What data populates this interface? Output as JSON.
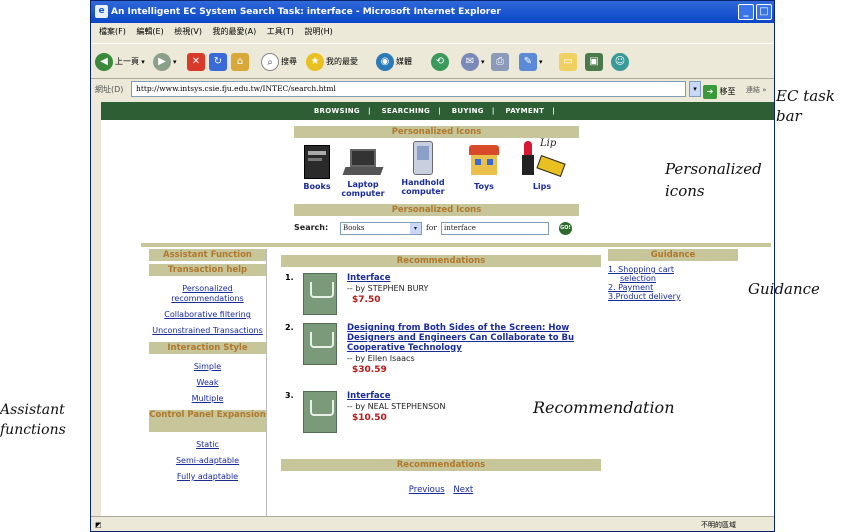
{
  "window": {
    "title": "An Intelligent EC System Search Task: interface - Microsoft Internet Explorer",
    "min": "_",
    "max": "□"
  },
  "menu": [
    "檔案(F)",
    "編輯(E)",
    "檢視(V)",
    "我的最愛(A)",
    "工具(T)",
    "說明(H)"
  ],
  "toolbar": {
    "back": "上一頁",
    "search": "搜尋",
    "favorites": "我的最愛",
    "media": "媒體"
  },
  "address": {
    "label": "網址(D)",
    "url": "http://www.intsys.csie.fju.edu.tw/INTEC/search.html",
    "go": "移至",
    "links": "連結"
  },
  "taskbar": [
    "BROWSING",
    "SEARCHING",
    "BUYING",
    "PAYMENT"
  ],
  "personalized": {
    "header": "Personalized Icons",
    "footer": "Personalized Icons",
    "icons": [
      {
        "label1": "Books",
        "label2": ""
      },
      {
        "label1": "Laptop",
        "label2": "computer"
      },
      {
        "label1": "Handhold",
        "label2": "computer"
      },
      {
        "label1": "Toys",
        "label2": ""
      },
      {
        "label1": "Lips",
        "label2": ""
      }
    ],
    "lip_text": "Lip"
  },
  "search": {
    "label": "Search:",
    "category": "Books",
    "for_label": "for",
    "query": "interface",
    "go": "GO!"
  },
  "assistant": {
    "header": "Assistant Function",
    "transaction_help": "Transaction help",
    "links_a": [
      "Personalized recommendations",
      "Collaborative filtering",
      "Unconstrained Transactions"
    ],
    "interaction_style": "Interaction Style",
    "links_b": [
      "Simple",
      "Weak",
      "Multiple"
    ],
    "control_panel": "Control Panel Expansion",
    "links_c": [
      "Static",
      "Semi-adaptable",
      "Fully adaptable"
    ]
  },
  "recommendations": {
    "header": "Recommendations",
    "footer": "Recommendations",
    "items": [
      {
        "num": "1.",
        "title": "Interface",
        "by": "-- by STEPHEN BURY",
        "price": "$7.50"
      },
      {
        "num": "2.",
        "title": "Designing from Both Sides of the Screen: How Designers and Engineers Can Collaborate to Build Cooperative Technology",
        "title_l1": "Designing from Both Sides of the Screen: How",
        "title_l2": "Designers and Engineers Can Collaborate to Bu",
        "title_l3": "Cooperative Technology",
        "by": "-- by Ellen Isaacs",
        "price": "$30.59"
      },
      {
        "num": "3.",
        "title": "Interface",
        "by": "-- by NEAL STEPHENSON",
        "price": "$10.50"
      }
    ],
    "prev": "Previous",
    "next": "Next"
  },
  "guidance": {
    "header": "Guidance",
    "items": [
      "1. Shopping cart",
      "selection",
      "2. Payment",
      "3.Product delivery"
    ]
  },
  "status": {
    "right": "不明的區域"
  },
  "annotations": {
    "ec_task_bar": "EC task bar",
    "ec_l1": "EC task",
    "ec_l2": "bar",
    "personalized_l1": "Personalized",
    "personalized_l2": "icons",
    "guidance": "Guidance",
    "recommendation": "Recommendation",
    "assistant_l1": "Assistant",
    "assistant_l2": "functions"
  },
  "colors": {
    "taskbar": "#2e5e33",
    "band": "#c7c69a",
    "band_text": "#b0782c",
    "link": "#1a2c9a",
    "price": "#b81818"
  }
}
